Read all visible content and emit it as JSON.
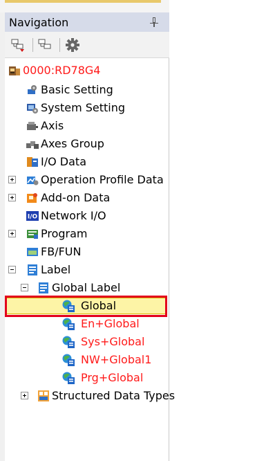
{
  "panel": {
    "title": "Navigation"
  },
  "toolbar": {
    "buttons": [
      {
        "icon": "expand-tree-icon"
      },
      {
        "icon": "collapse-tree-icon"
      },
      {
        "icon": "gear-icon"
      }
    ]
  },
  "tree": {
    "project": {
      "label": "0000:RD78G4",
      "icon": "module-icon",
      "color": "#ff1a1a"
    },
    "items": [
      {
        "label": "Basic Setting",
        "icon": "basic-setting-icon",
        "expander": "none",
        "level": 1,
        "highlight": "none"
      },
      {
        "label": "System Setting",
        "icon": "system-setting-icon",
        "expander": "none",
        "level": 1,
        "highlight": "none"
      },
      {
        "label": "Axis",
        "icon": "axis-icon",
        "expander": "none",
        "level": 1,
        "highlight": "none"
      },
      {
        "label": "Axes Group",
        "icon": "axes-group-icon",
        "expander": "none",
        "level": 1,
        "highlight": "none"
      },
      {
        "label": "I/O Data",
        "icon": "io-data-icon",
        "expander": "none",
        "level": 1,
        "highlight": "none"
      },
      {
        "label": "Operation Profile Data",
        "icon": "operation-profile-icon",
        "expander": "plus",
        "level": 1,
        "highlight": "none"
      },
      {
        "label": "Add-on Data",
        "icon": "add-on-icon",
        "expander": "plus",
        "level": 1,
        "highlight": "none"
      },
      {
        "label": "Network I/O",
        "icon": "network-io-icon",
        "expander": "none",
        "level": 1,
        "highlight": "none"
      },
      {
        "label": "Program",
        "icon": "program-icon",
        "expander": "plus",
        "level": 1,
        "highlight": "none"
      },
      {
        "label": "FB/FUN",
        "icon": "fb-fun-icon",
        "expander": "none",
        "level": 1,
        "highlight": "none"
      },
      {
        "label": "Label",
        "icon": "label-icon",
        "expander": "minus",
        "level": 1,
        "highlight": "none"
      },
      {
        "label": "Global Label",
        "icon": "label-icon",
        "expander": "minus",
        "level": 2,
        "highlight": "none"
      },
      {
        "label": "Global",
        "icon": "global-label-icon",
        "expander": "none",
        "level": 3,
        "highlight": "selected"
      },
      {
        "label": "En+Global",
        "icon": "global-label-icon",
        "expander": "none",
        "level": 3,
        "highlight": "red-text"
      },
      {
        "label": "Sys+Global",
        "icon": "global-label-icon",
        "expander": "none",
        "level": 3,
        "highlight": "red-text"
      },
      {
        "label": "NW+Global1",
        "icon": "global-label-icon",
        "expander": "none",
        "level": 3,
        "highlight": "red-text"
      },
      {
        "label": "Prg+Global",
        "icon": "global-label-icon",
        "expander": "none",
        "level": 3,
        "highlight": "red-text"
      },
      {
        "label": "Structured Data Types",
        "icon": "structured-data-icon",
        "expander": "plus",
        "level": 2,
        "highlight": "none"
      }
    ]
  },
  "colors": {
    "title_bar": "#d6dbe9",
    "selection_fill": "#fdf4a6",
    "callout_red": "#e3001b",
    "error_text": "#ff1a1a"
  }
}
